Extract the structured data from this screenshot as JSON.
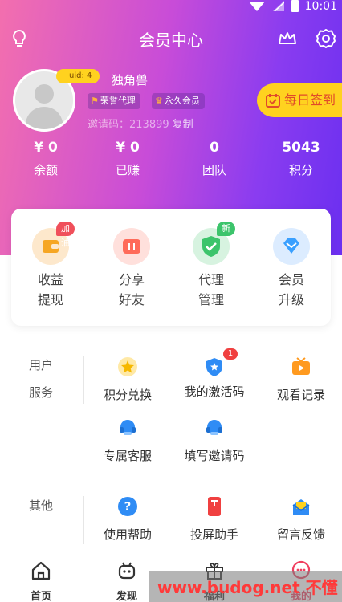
{
  "status": {
    "time": "10:01"
  },
  "header": {
    "title": "会员中心"
  },
  "profile": {
    "uid": "uid: 4",
    "name": "独角兽",
    "tags": [
      "荣誉代理",
      "永久会员"
    ],
    "invite_label": "邀请码：213899",
    "copy_label": "复制"
  },
  "signin": {
    "label": "每日签到"
  },
  "stats": [
    {
      "value": "¥ 0",
      "label": "余额"
    },
    {
      "value": "¥ 0",
      "label": "已赚"
    },
    {
      "value": "0",
      "label": "团队"
    },
    {
      "value": "5043",
      "label": "积分"
    }
  ],
  "features": [
    {
      "label": "收益\n提现",
      "badge": "加油",
      "icon": "wallet-icon",
      "color": "#f6a623"
    },
    {
      "label": "分享\n好友",
      "badge": "",
      "icon": "share-icon",
      "color": "#ff6b5a"
    },
    {
      "label": "代理\n管理",
      "badge": "新",
      "icon": "shield-check-icon",
      "color": "#3cc46b"
    },
    {
      "label": "会员\n升级",
      "badge": "",
      "icon": "diamond-icon",
      "color": "#3aa0ff"
    }
  ],
  "user_services": {
    "label_lines": [
      "用户",
      "服务"
    ],
    "items": [
      {
        "label": "积分兑换",
        "icon": "star-icon"
      },
      {
        "label": "我的激活码",
        "icon": "shield-star-icon",
        "badge": "1"
      },
      {
        "label": "观看记录",
        "icon": "tv-icon"
      },
      {
        "label": "专属客服",
        "icon": "headset-icon"
      },
      {
        "label": "填写邀请码",
        "icon": "headset-icon"
      }
    ]
  },
  "other": {
    "label": "其他",
    "items": [
      {
        "label": "使用帮助",
        "icon": "help-icon"
      },
      {
        "label": "投屏助手",
        "icon": "cast-icon"
      },
      {
        "label": "留言反馈",
        "icon": "mail-icon"
      }
    ]
  },
  "bottom_nav": [
    {
      "label": "首页",
      "icon": "home-icon"
    },
    {
      "label": "发现",
      "icon": "robot-icon"
    },
    {
      "label": "福利",
      "icon": "gift-icon"
    },
    {
      "label": "我的",
      "icon": "chat-icon"
    }
  ],
  "watermark": "www.budog.net 不懂社区"
}
